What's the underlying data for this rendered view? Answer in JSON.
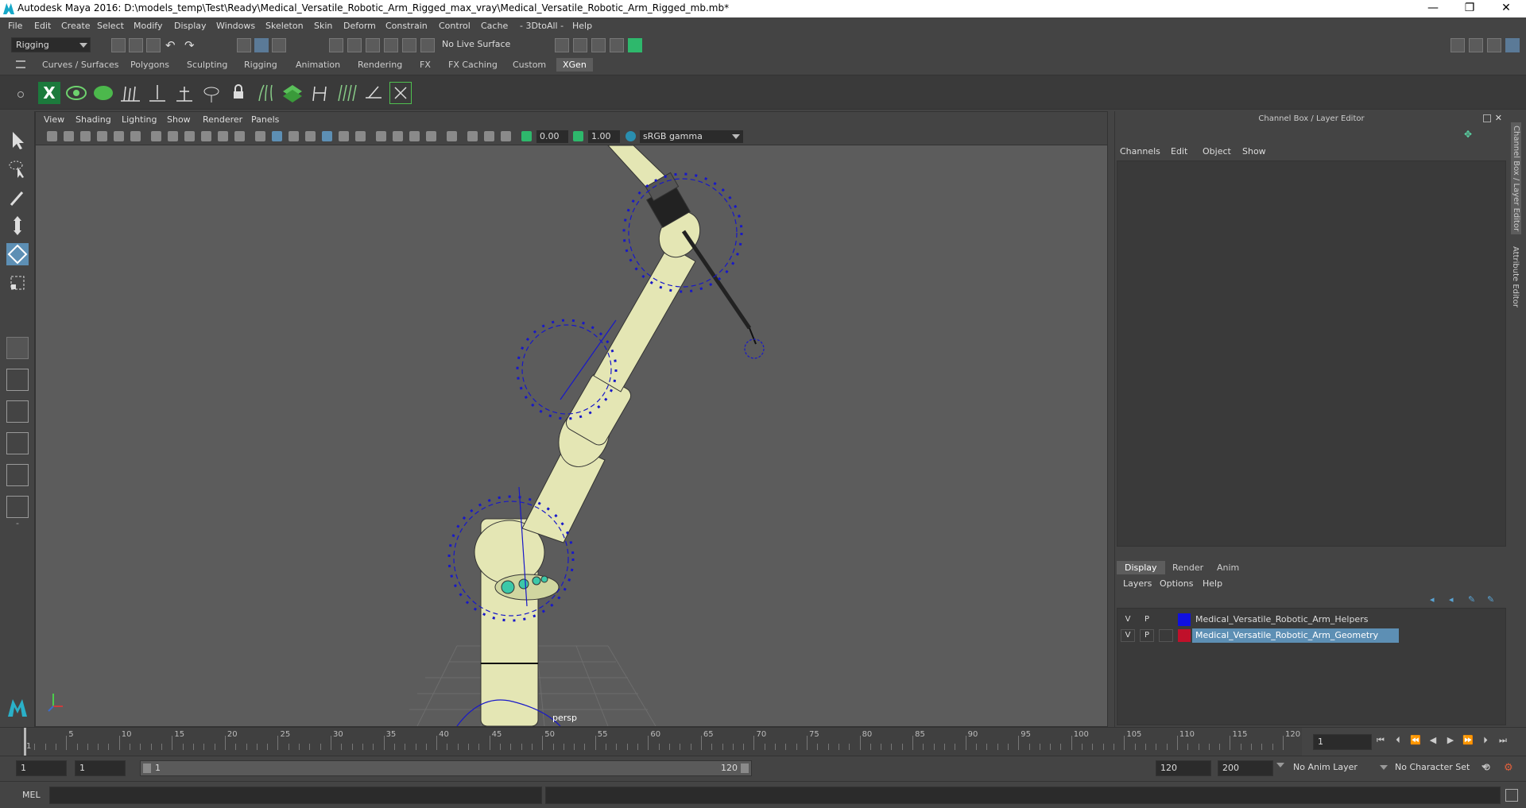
{
  "window": {
    "title": "Autodesk Maya 2016: D:\\models_temp\\Test\\Ready\\Medical_Versatile_Robotic_Arm_Rigged_max_vray\\Medical_Versatile_Robotic_Arm_Rigged_mb.mb*",
    "minimize": "—",
    "restore": "❐",
    "close": "✕"
  },
  "menus": [
    "File",
    "Edit",
    "Create",
    "Select",
    "Modify",
    "Display",
    "Windows",
    "Skeleton",
    "Skin",
    "Deform",
    "Constrain",
    "Control",
    "Cache",
    "- 3DtoAll -",
    "Help"
  ],
  "status_line": {
    "mode": "Rigging",
    "live_surface": "No Live Surface"
  },
  "shelf_tabs": [
    "Curves / Surfaces",
    "Polygons",
    "Sculpting",
    "Rigging",
    "Animation",
    "Rendering",
    "FX",
    "FX Caching",
    "Custom",
    "XGen"
  ],
  "active_shelf_tab": "XGen",
  "panel_menu": [
    "View",
    "Shading",
    "Lighting",
    "Show",
    "Renderer",
    "Panels"
  ],
  "panel_toolbar": {
    "exposure": "0.00",
    "gamma": "1.00",
    "color_space": "sRGB gamma"
  },
  "viewport": {
    "camera_label": "persp"
  },
  "channel_box": {
    "title": "Channel Box / Layer Editor",
    "menu": [
      "Channels",
      "Edit",
      "Object",
      "Show"
    ]
  },
  "layer_editor": {
    "tabs": [
      "Display",
      "Render",
      "Anim"
    ],
    "active_tab": "Display",
    "menu": [
      "Layers",
      "Options",
      "Help"
    ],
    "layers": [
      {
        "v": "V",
        "p": "P",
        "color": "#1010e0",
        "name": "Medical_Versatile_Robotic_Arm_Helpers",
        "selected": false
      },
      {
        "v": "V",
        "p": "P",
        "color": "#c0102a",
        "name": "Medical_Versatile_Robotic_Arm_Geometry",
        "selected": true
      }
    ]
  },
  "side_tabs": [
    "Channel Box / Layer Editor",
    "Attribute Editor"
  ],
  "time_slider": {
    "ticks": [
      "1",
      "5",
      "10",
      "15",
      "20",
      "25",
      "30",
      "35",
      "40",
      "45",
      "50",
      "55",
      "60",
      "65",
      "70",
      "75",
      "80",
      "85",
      "90",
      "95",
      "100",
      "105",
      "110",
      "115",
      "120"
    ],
    "current_frame": "1"
  },
  "range_slider": {
    "start": "1",
    "playback_start": "1",
    "range_start": "1",
    "range_end": "120",
    "playback_end": "120",
    "end": "200",
    "anim_layer": "No Anim Layer",
    "character_set": "No Character Set"
  },
  "command_line": {
    "label": "MEL"
  }
}
